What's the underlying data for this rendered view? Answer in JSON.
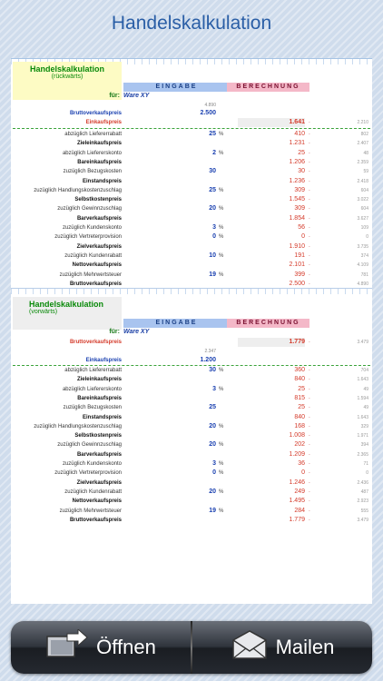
{
  "title": "Handelskalkulation",
  "section1": {
    "heading": "Handelskalkulation",
    "sub": "(rückwärts)",
    "eingabe": "EINGABE",
    "berechnung": "BERECHNUNG",
    "fur": "für:",
    "ware": "Ware XY",
    "smallnum": "4.890",
    "brutto_label": "Bruttoverkaufspreis",
    "brutto_value": "2.500",
    "einkauf_label": "Einkaufspreis",
    "einkauf_value": "1.641",
    "einkauf_side": "2.210",
    "rows": [
      {
        "label": "abzüglich Liefererrabatt",
        "input": "25",
        "pct": "%",
        "value": "410",
        "side": "802",
        "bold": false
      },
      {
        "label": "Zieleinkaufspreis",
        "input": "",
        "pct": "",
        "value": "1.231",
        "side": "2.407",
        "bold": true
      },
      {
        "label": "abzüglich Liefererskonto",
        "input": "2",
        "pct": "%",
        "value": "25",
        "side": "48",
        "bold": false
      },
      {
        "label": "Bareinkaufspreis",
        "input": "",
        "pct": "",
        "value": "1.206",
        "side": "2.359",
        "bold": true
      },
      {
        "label": "zuzüglich Bezugskosten",
        "input": "30",
        "pct": "",
        "value": "30",
        "side": "59",
        "bold": false
      },
      {
        "label": "Einstandspreis",
        "input": "",
        "pct": "",
        "value": "1.236",
        "side": "2.418",
        "bold": true
      },
      {
        "label": "zuzüglich Handlungskostenzuschlag",
        "input": "25",
        "pct": "%",
        "value": "309",
        "side": "604",
        "bold": false
      },
      {
        "label": "Selbstkostenpreis",
        "input": "",
        "pct": "",
        "value": "1.545",
        "side": "3.022",
        "bold": true
      },
      {
        "label": "zuzüglich Gewinnzuschlag",
        "input": "20",
        "pct": "%",
        "value": "309",
        "side": "604",
        "bold": false
      },
      {
        "label": "Barverkaufspreis",
        "input": "",
        "pct": "",
        "value": "1.854",
        "side": "3.627",
        "bold": true
      },
      {
        "label": "zuzüglich Kundenskonto",
        "input": "3",
        "pct": "%",
        "value": "56",
        "side": "109",
        "bold": false
      },
      {
        "label": "zuzüglich Vertreterprovision",
        "input": "0",
        "pct": "%",
        "value": "0",
        "side": "0",
        "bold": false
      },
      {
        "label": "Zielverkaufspreis",
        "input": "",
        "pct": "",
        "value": "1.910",
        "side": "3.735",
        "bold": true
      },
      {
        "label": "zuzüglich Kundenrabatt",
        "input": "10",
        "pct": "%",
        "value": "191",
        "side": "374",
        "bold": false
      },
      {
        "label": "Nettoverkaufspreis",
        "input": "",
        "pct": "",
        "value": "2.101",
        "side": "4.109",
        "bold": true
      },
      {
        "label": "zuzüglich Mehrwertsteuer",
        "input": "19",
        "pct": "%",
        "value": "399",
        "side": "781",
        "bold": false
      },
      {
        "label": "Bruttoverkaufspreis",
        "input": "",
        "pct": "",
        "value": "2.500",
        "side": "4.890",
        "bold": true
      }
    ]
  },
  "section2": {
    "heading": "Handelskalkulation",
    "sub": "(vorwärts)",
    "eingabe": "EINGABE",
    "berechnung": "BERECHNUNG",
    "fur": "für:",
    "ware": "Ware XY",
    "brutto_label": "Bruttoverkaufspreis",
    "brutto_value": "1.779",
    "brutto_side": "3.479",
    "smallnum": "2.347",
    "einkauf_label": "Einkaufspreis",
    "einkauf_value": "1.200",
    "rows": [
      {
        "label": "abzüglich Liefererrabatt",
        "input": "30",
        "pct": "%",
        "value": "360",
        "side": "704",
        "bold": false
      },
      {
        "label": "Zieleinkaufspreis",
        "input": "",
        "pct": "",
        "value": "840",
        "side": "1.643",
        "bold": true
      },
      {
        "label": "abzüglich Liefererskonto",
        "input": "3",
        "pct": "%",
        "value": "25",
        "side": "49",
        "bold": false
      },
      {
        "label": "Bareinkaufspreis",
        "input": "",
        "pct": "",
        "value": "815",
        "side": "1.594",
        "bold": true
      },
      {
        "label": "zuzüglich Bezugskosten",
        "input": "25",
        "pct": "",
        "value": "25",
        "side": "49",
        "bold": false
      },
      {
        "label": "Einstandspreis",
        "input": "",
        "pct": "",
        "value": "840",
        "side": "1.643",
        "bold": true
      },
      {
        "label": "zuzüglich Handlungskostenzuschlag",
        "input": "20",
        "pct": "%",
        "value": "168",
        "side": "329",
        "bold": false
      },
      {
        "label": "Selbstkostenpreis",
        "input": "",
        "pct": "",
        "value": "1.008",
        "side": "1.971",
        "bold": true
      },
      {
        "label": "zuzüglich Gewinnzuschlag",
        "input": "20",
        "pct": "%",
        "value": "202",
        "side": "394",
        "bold": false
      },
      {
        "label": "Barverkaufspreis",
        "input": "",
        "pct": "",
        "value": "1.209",
        "side": "2.365",
        "bold": true
      },
      {
        "label": "zuzüglich Kundenskonto",
        "input": "3",
        "pct": "%",
        "value": "36",
        "side": "71",
        "bold": false
      },
      {
        "label": "zuzüglich Vertreterprovision",
        "input": "0",
        "pct": "%",
        "value": "0",
        "side": "0",
        "bold": false
      },
      {
        "label": "Zielverkaufspreis",
        "input": "",
        "pct": "",
        "value": "1.246",
        "side": "2.436",
        "bold": true
      },
      {
        "label": "zuzüglich Kundenrabatt",
        "input": "20",
        "pct": "%",
        "value": "249",
        "side": "487",
        "bold": false
      },
      {
        "label": "Nettoverkaufspreis",
        "input": "",
        "pct": "",
        "value": "1.495",
        "side": "2.923",
        "bold": true
      },
      {
        "label": "zuzüglich Mehrwertsteuer",
        "input": "19",
        "pct": "%",
        "value": "284",
        "side": "555",
        "bold": false
      },
      {
        "label": "Bruttoverkaufspreis",
        "input": "",
        "pct": "",
        "value": "1.779",
        "side": "3.479",
        "bold": true
      }
    ]
  },
  "currency": "-",
  "toolbar": {
    "open_label": "Öffnen",
    "mail_label": "Mailen"
  },
  "colors": {
    "title": "#2a5ea6",
    "input": "#1a40b0",
    "result": "#d43a2a",
    "heading": "#0a8a0a"
  }
}
